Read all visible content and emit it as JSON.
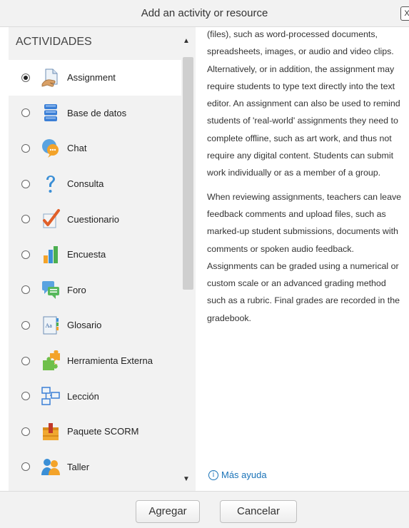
{
  "dialog": {
    "title": "Add an activity or resource",
    "close_label": "X"
  },
  "sidebar": {
    "section_title": "ACTIVIDADES",
    "items": [
      {
        "label": "Assignment",
        "icon": "assignment-icon",
        "selected": true
      },
      {
        "label": "Base de datos",
        "icon": "database-icon",
        "selected": false
      },
      {
        "label": "Chat",
        "icon": "chat-icon",
        "selected": false
      },
      {
        "label": "Consulta",
        "icon": "question-icon",
        "selected": false
      },
      {
        "label": "Cuestionario",
        "icon": "checkmark-icon",
        "selected": false
      },
      {
        "label": "Encuesta",
        "icon": "bar-chart-icon",
        "selected": false
      },
      {
        "label": "Foro",
        "icon": "forum-icon",
        "selected": false
      },
      {
        "label": "Glosario",
        "icon": "glossary-icon",
        "selected": false
      },
      {
        "label": "Herramienta Externa",
        "icon": "puzzle-icon",
        "selected": false
      },
      {
        "label": "Lección",
        "icon": "lesson-icon",
        "selected": false
      },
      {
        "label": "Paquete SCORM",
        "icon": "package-icon",
        "selected": false
      },
      {
        "label": "Taller",
        "icon": "workshop-icon",
        "selected": false
      }
    ]
  },
  "help": {
    "paragraph_1": "(files), such as word-processed documents, spreadsheets, images, or audio and video clips. Alternatively, or in addition, the assignment may require students to type text directly into the text editor. An assignment can also be used to remind students of 'real-world' assignments they need to complete offline, such as art work, and thus not require any digital content. Students can submit work individually or as a member of a group.",
    "paragraph_2": "When reviewing assignments, teachers can leave feedback comments and upload files, such as marked-up student submissions, documents with comments or spoken audio feedback. Assignments can be graded using a numerical or custom scale or an advanced grading method such as a rubric. Final grades are recorded in the gradebook.",
    "more_help": "Más ayuda"
  },
  "footer": {
    "add_label": "Agregar",
    "cancel_label": "Cancelar"
  }
}
